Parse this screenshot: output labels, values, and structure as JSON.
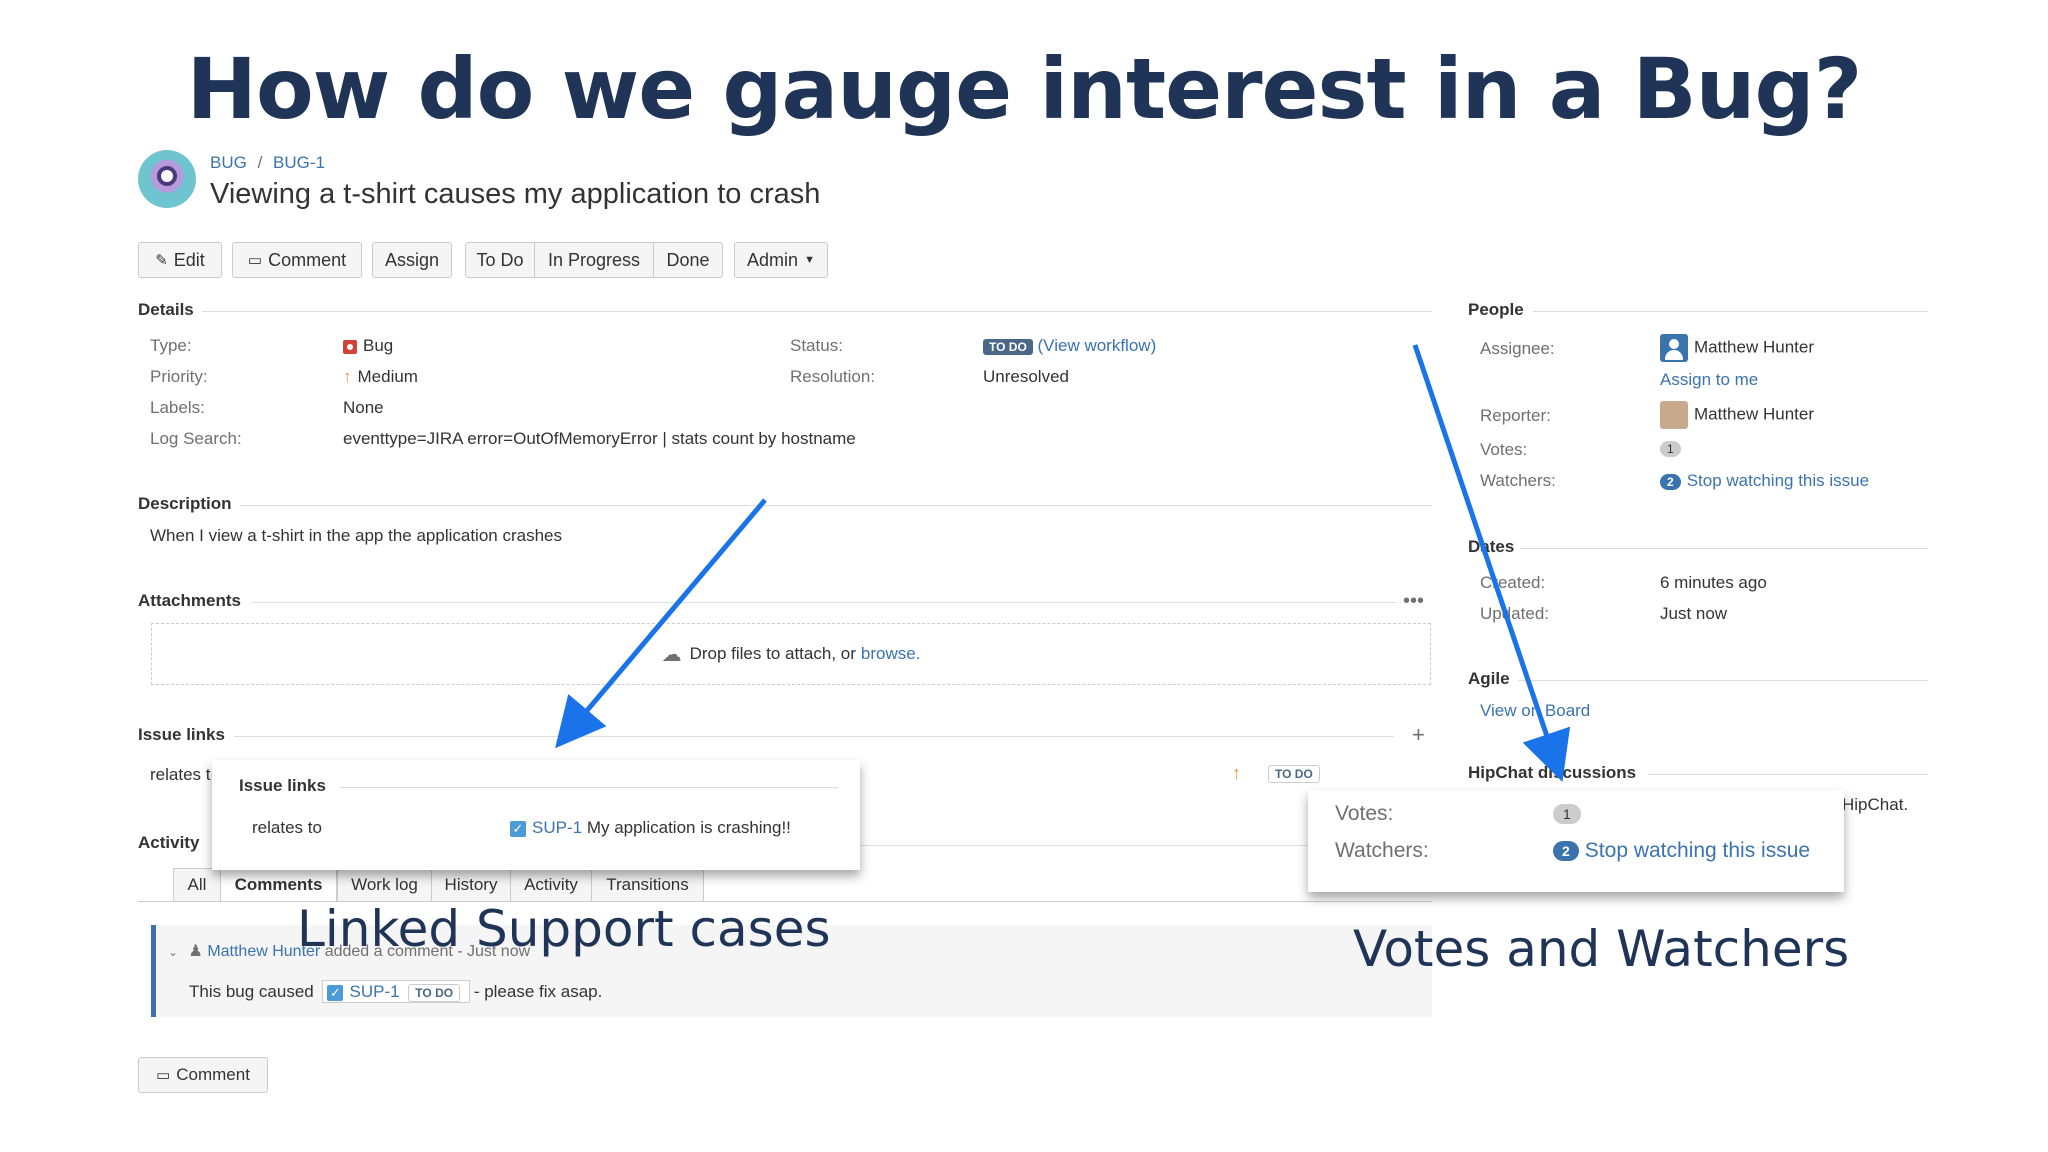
{
  "slide": {
    "title": "How do we gauge interest in a Bug?",
    "annotation_links": "Linked Support cases",
    "annotation_votes": "Votes and Watchers",
    "arrow_color": "#1a73e8"
  },
  "issue": {
    "breadcrumb_project": "BUG",
    "breadcrumb_sep": "/",
    "breadcrumb_key": "BUG-1",
    "title": "Viewing a t-shirt causes my application to crash"
  },
  "toolbar": {
    "edit": "Edit",
    "comment": "Comment",
    "assign": "Assign",
    "todo": "To Do",
    "in_progress": "In Progress",
    "done": "Done",
    "admin": "Admin"
  },
  "details": {
    "heading": "Details",
    "type_label": "Type:",
    "type_value": "Bug",
    "priority_label": "Priority:",
    "priority_value": "Medium",
    "labels_label": "Labels:",
    "labels_value": "None",
    "logsearch_label": "Log Search:",
    "logsearch_value": "eventtype=JIRA error=OutOfMemoryError | stats count by hostname",
    "status_label": "Status:",
    "status_value": "TO DO",
    "status_link": "(View workflow)",
    "resolution_label": "Resolution:",
    "resolution_value": "Unresolved"
  },
  "description": {
    "heading": "Description",
    "text": "When I view a t-shirt in the app the application crashes"
  },
  "attachments": {
    "heading": "Attachments",
    "drop_text": "Drop files to attach, or",
    "browse": "browse."
  },
  "issue_links": {
    "heading": "Issue links",
    "row_prefix": "relates t",
    "row_status": "TO DO",
    "popup_heading": "Issue links",
    "popup_relation": "relates to",
    "popup_key": "SUP-1",
    "popup_summary": "My application is crashing!!"
  },
  "activity": {
    "heading": "Activity",
    "tabs": [
      "All",
      "Comments",
      "Work log",
      "History",
      "Activity",
      "Transitions"
    ],
    "comment_author": "Matthew Hunter",
    "comment_meta": "added a comment - Just now",
    "comment_prefix": "This bug caused",
    "comment_key": "SUP-1",
    "comment_status": "TO DO",
    "comment_suffix": "- please fix asap.",
    "comment_button": "Comment"
  },
  "people": {
    "heading": "People",
    "assignee_label": "Assignee:",
    "assignee_value": "Matthew Hunter",
    "assign_to_me": "Assign to me",
    "reporter_label": "Reporter:",
    "reporter_value": "Matthew Hunter",
    "votes_label": "Votes:",
    "votes_count": "1",
    "watchers_label": "Watchers:",
    "watchers_count": "2",
    "watchers_link": "Stop watching this issue"
  },
  "dates": {
    "heading": "Dates",
    "created_label": "Created:",
    "created_value": "6 minutes ago",
    "updated_label": "Updated:",
    "updated_value": "Just now"
  },
  "agile": {
    "heading": "Agile",
    "link": "View on Board"
  },
  "hipchat": {
    "heading": "HipChat discussions",
    "trailing": "HipChat."
  },
  "votes_popup": {
    "votes_label": "Votes:",
    "votes_count": "1",
    "watchers_label": "Watchers:",
    "watchers_count": "2",
    "watchers_link": "Stop watching this issue"
  }
}
